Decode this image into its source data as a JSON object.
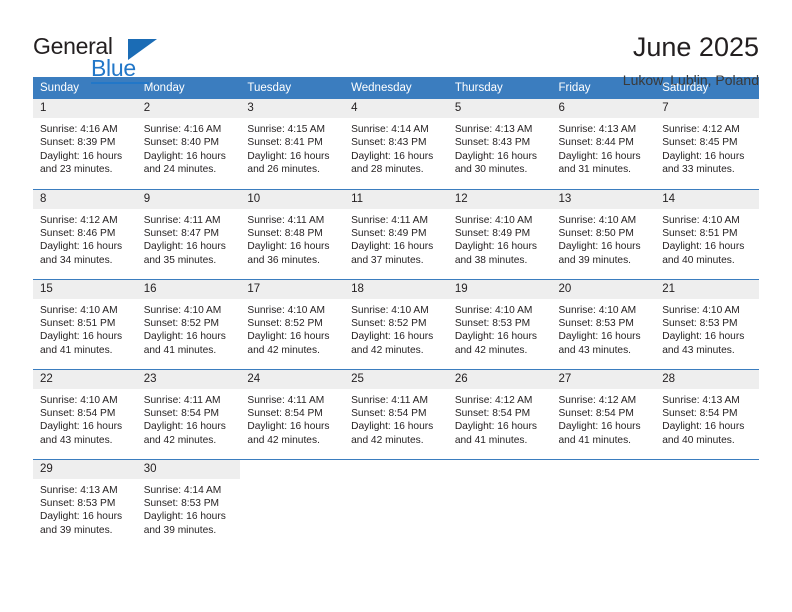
{
  "logo": {
    "name_top": "General",
    "name_bottom": "Blue",
    "accent_color": "#2277c8",
    "triangle_color": "#1b6cb5"
  },
  "header": {
    "title": "June 2025",
    "subtitle": "Lukow, Lublin, Poland"
  },
  "calendar": {
    "header_bg": "#3b7dbf",
    "daynum_bg": "#eeeeee",
    "weekday_headers": [
      "Sunday",
      "Monday",
      "Tuesday",
      "Wednesday",
      "Thursday",
      "Friday",
      "Saturday"
    ],
    "labels": {
      "sunrise": "Sunrise:",
      "sunset": "Sunset:",
      "daylight": "Daylight:"
    },
    "weeks": [
      [
        {
          "day": "1",
          "sunrise": "Sunrise: 4:16 AM",
          "sunset": "Sunset: 8:39 PM",
          "daylight_1": "Daylight: 16 hours",
          "daylight_2": "and 23 minutes."
        },
        {
          "day": "2",
          "sunrise": "Sunrise: 4:16 AM",
          "sunset": "Sunset: 8:40 PM",
          "daylight_1": "Daylight: 16 hours",
          "daylight_2": "and 24 minutes."
        },
        {
          "day": "3",
          "sunrise": "Sunrise: 4:15 AM",
          "sunset": "Sunset: 8:41 PM",
          "daylight_1": "Daylight: 16 hours",
          "daylight_2": "and 26 minutes."
        },
        {
          "day": "4",
          "sunrise": "Sunrise: 4:14 AM",
          "sunset": "Sunset: 8:43 PM",
          "daylight_1": "Daylight: 16 hours",
          "daylight_2": "and 28 minutes."
        },
        {
          "day": "5",
          "sunrise": "Sunrise: 4:13 AM",
          "sunset": "Sunset: 8:43 PM",
          "daylight_1": "Daylight: 16 hours",
          "daylight_2": "and 30 minutes."
        },
        {
          "day": "6",
          "sunrise": "Sunrise: 4:13 AM",
          "sunset": "Sunset: 8:44 PM",
          "daylight_1": "Daylight: 16 hours",
          "daylight_2": "and 31 minutes."
        },
        {
          "day": "7",
          "sunrise": "Sunrise: 4:12 AM",
          "sunset": "Sunset: 8:45 PM",
          "daylight_1": "Daylight: 16 hours",
          "daylight_2": "and 33 minutes."
        }
      ],
      [
        {
          "day": "8",
          "sunrise": "Sunrise: 4:12 AM",
          "sunset": "Sunset: 8:46 PM",
          "daylight_1": "Daylight: 16 hours",
          "daylight_2": "and 34 minutes."
        },
        {
          "day": "9",
          "sunrise": "Sunrise: 4:11 AM",
          "sunset": "Sunset: 8:47 PM",
          "daylight_1": "Daylight: 16 hours",
          "daylight_2": "and 35 minutes."
        },
        {
          "day": "10",
          "sunrise": "Sunrise: 4:11 AM",
          "sunset": "Sunset: 8:48 PM",
          "daylight_1": "Daylight: 16 hours",
          "daylight_2": "and 36 minutes."
        },
        {
          "day": "11",
          "sunrise": "Sunrise: 4:11 AM",
          "sunset": "Sunset: 8:49 PM",
          "daylight_1": "Daylight: 16 hours",
          "daylight_2": "and 37 minutes."
        },
        {
          "day": "12",
          "sunrise": "Sunrise: 4:10 AM",
          "sunset": "Sunset: 8:49 PM",
          "daylight_1": "Daylight: 16 hours",
          "daylight_2": "and 38 minutes."
        },
        {
          "day": "13",
          "sunrise": "Sunrise: 4:10 AM",
          "sunset": "Sunset: 8:50 PM",
          "daylight_1": "Daylight: 16 hours",
          "daylight_2": "and 39 minutes."
        },
        {
          "day": "14",
          "sunrise": "Sunrise: 4:10 AM",
          "sunset": "Sunset: 8:51 PM",
          "daylight_1": "Daylight: 16 hours",
          "daylight_2": "and 40 minutes."
        }
      ],
      [
        {
          "day": "15",
          "sunrise": "Sunrise: 4:10 AM",
          "sunset": "Sunset: 8:51 PM",
          "daylight_1": "Daylight: 16 hours",
          "daylight_2": "and 41 minutes."
        },
        {
          "day": "16",
          "sunrise": "Sunrise: 4:10 AM",
          "sunset": "Sunset: 8:52 PM",
          "daylight_1": "Daylight: 16 hours",
          "daylight_2": "and 41 minutes."
        },
        {
          "day": "17",
          "sunrise": "Sunrise: 4:10 AM",
          "sunset": "Sunset: 8:52 PM",
          "daylight_1": "Daylight: 16 hours",
          "daylight_2": "and 42 minutes."
        },
        {
          "day": "18",
          "sunrise": "Sunrise: 4:10 AM",
          "sunset": "Sunset: 8:52 PM",
          "daylight_1": "Daylight: 16 hours",
          "daylight_2": "and 42 minutes."
        },
        {
          "day": "19",
          "sunrise": "Sunrise: 4:10 AM",
          "sunset": "Sunset: 8:53 PM",
          "daylight_1": "Daylight: 16 hours",
          "daylight_2": "and 42 minutes."
        },
        {
          "day": "20",
          "sunrise": "Sunrise: 4:10 AM",
          "sunset": "Sunset: 8:53 PM",
          "daylight_1": "Daylight: 16 hours",
          "daylight_2": "and 43 minutes."
        },
        {
          "day": "21",
          "sunrise": "Sunrise: 4:10 AM",
          "sunset": "Sunset: 8:53 PM",
          "daylight_1": "Daylight: 16 hours",
          "daylight_2": "and 43 minutes."
        }
      ],
      [
        {
          "day": "22",
          "sunrise": "Sunrise: 4:10 AM",
          "sunset": "Sunset: 8:54 PM",
          "daylight_1": "Daylight: 16 hours",
          "daylight_2": "and 43 minutes."
        },
        {
          "day": "23",
          "sunrise": "Sunrise: 4:11 AM",
          "sunset": "Sunset: 8:54 PM",
          "daylight_1": "Daylight: 16 hours",
          "daylight_2": "and 42 minutes."
        },
        {
          "day": "24",
          "sunrise": "Sunrise: 4:11 AM",
          "sunset": "Sunset: 8:54 PM",
          "daylight_1": "Daylight: 16 hours",
          "daylight_2": "and 42 minutes."
        },
        {
          "day": "25",
          "sunrise": "Sunrise: 4:11 AM",
          "sunset": "Sunset: 8:54 PM",
          "daylight_1": "Daylight: 16 hours",
          "daylight_2": "and 42 minutes."
        },
        {
          "day": "26",
          "sunrise": "Sunrise: 4:12 AM",
          "sunset": "Sunset: 8:54 PM",
          "daylight_1": "Daylight: 16 hours",
          "daylight_2": "and 41 minutes."
        },
        {
          "day": "27",
          "sunrise": "Sunrise: 4:12 AM",
          "sunset": "Sunset: 8:54 PM",
          "daylight_1": "Daylight: 16 hours",
          "daylight_2": "and 41 minutes."
        },
        {
          "day": "28",
          "sunrise": "Sunrise: 4:13 AM",
          "sunset": "Sunset: 8:54 PM",
          "daylight_1": "Daylight: 16 hours",
          "daylight_2": "and 40 minutes."
        }
      ],
      [
        {
          "day": "29",
          "sunrise": "Sunrise: 4:13 AM",
          "sunset": "Sunset: 8:53 PM",
          "daylight_1": "Daylight: 16 hours",
          "daylight_2": "and 39 minutes."
        },
        {
          "day": "30",
          "sunrise": "Sunrise: 4:14 AM",
          "sunset": "Sunset: 8:53 PM",
          "daylight_1": "Daylight: 16 hours",
          "daylight_2": "and 39 minutes."
        },
        {
          "day": "",
          "sunrise": "",
          "sunset": "",
          "daylight_1": "",
          "daylight_2": ""
        },
        {
          "day": "",
          "sunrise": "",
          "sunset": "",
          "daylight_1": "",
          "daylight_2": ""
        },
        {
          "day": "",
          "sunrise": "",
          "sunset": "",
          "daylight_1": "",
          "daylight_2": ""
        },
        {
          "day": "",
          "sunrise": "",
          "sunset": "",
          "daylight_1": "",
          "daylight_2": ""
        },
        {
          "day": "",
          "sunrise": "",
          "sunset": "",
          "daylight_1": "",
          "daylight_2": ""
        }
      ]
    ]
  }
}
